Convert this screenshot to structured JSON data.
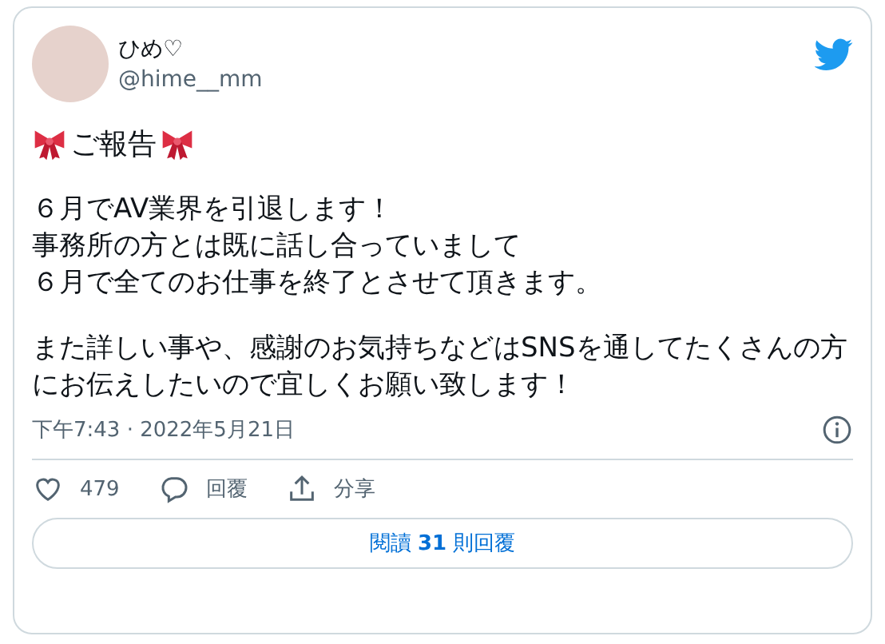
{
  "author": {
    "name": "ひめ♡",
    "handle": "@hime__mm"
  },
  "headline": "ご報告",
  "paragraphs": [
    [
      "６月でAV業界を引退します！",
      "事務所の方とは既に話し合っていまして",
      "６月で全てのお仕事を終了とさせて頂きます。"
    ],
    [
      "また詳しい事や、感謝のお気持ちなどはSNSを通してたくさんの方にお伝えしたいので宜しくお願い致します！"
    ]
  ],
  "timestamp": "下午7:43 · 2022年5月21日",
  "actions": [
    {
      "kind": "like",
      "label": "479"
    },
    {
      "kind": "reply",
      "label": "回覆"
    },
    {
      "kind": "share",
      "label": "分享"
    }
  ],
  "read_replies": "閱讀 **31** 則回覆"
}
